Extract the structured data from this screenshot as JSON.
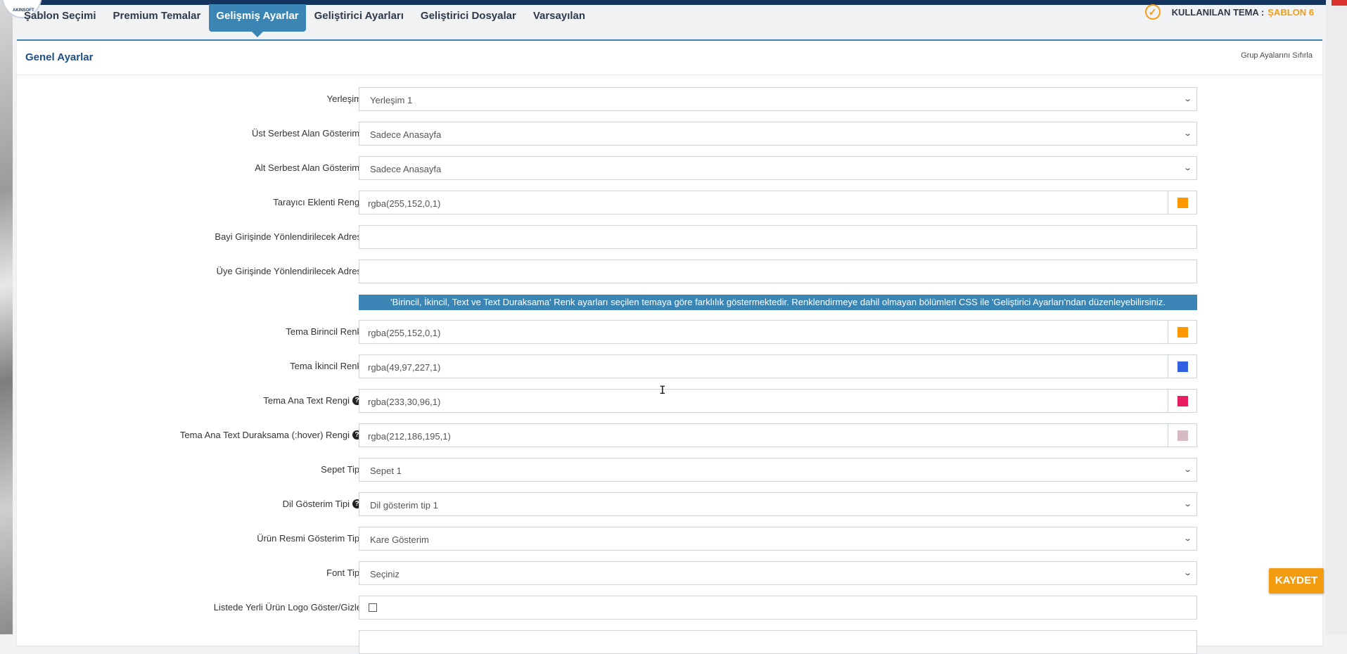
{
  "logo": {
    "text": "AKINSOFT"
  },
  "nav": {
    "tabs": [
      {
        "label": "Şablon Seçimi"
      },
      {
        "label": "Premium Temalar"
      },
      {
        "label": "Gelişmiş Ayarlar"
      },
      {
        "label": "Geliştirici Ayarları"
      },
      {
        "label": "Geliştirici Dosyalar"
      },
      {
        "label": "Varsayılan"
      }
    ],
    "active_index": 2
  },
  "active_theme": {
    "label": "KULLANILAN TEMA :",
    "name": "ŞABLON 6",
    "icon": "check-circle-icon"
  },
  "panel": {
    "title": "Genel Ayarlar",
    "reset_link": "Grup Ayalarını Sıfırla"
  },
  "form": {
    "layout": {
      "label": "Yerleşim",
      "value": "Yerleşim 1"
    },
    "top_free_area": {
      "label": "Üst Serbest Alan Gösterimi",
      "value": "Sadece Anasayfa"
    },
    "bottom_free_area": {
      "label": "Alt Serbest Alan Gösterimi",
      "value": "Sadece Anasayfa"
    },
    "browser_addon_color": {
      "label": "Tarayıcı Eklenti Rengi",
      "value": "rgba(255,152,0,1)",
      "swatch": "#ff9800"
    },
    "dealer_redirect": {
      "label": "Bayi Girişinde Yönlendirilecek Adres",
      "value": ""
    },
    "member_redirect": {
      "label": "Üye Girişinde Yönlendirilecek Adres",
      "value": ""
    },
    "info": "'Birincil, İkincil, Text ve Text Duraksama' Renk ayarları seçilen temaya göre farklılık göstermektedir. Renklendirmeye dahil olmayan bölümleri CSS ile 'Geliştirici Ayarları'ndan düzenleyebilirsiniz.",
    "primary_color": {
      "label": "Tema Birincil Renk",
      "value": "rgba(255,152,0,1)",
      "swatch": "#ff9800"
    },
    "secondary_color": {
      "label": "Tema İkincil Renk",
      "value": "rgba(49,97,227,1)",
      "swatch": "#3161e3"
    },
    "text_color": {
      "label": "Tema Ana Text Rengi",
      "value": "rgba(233,30,96,1)",
      "swatch": "#e91e60"
    },
    "hover_color": {
      "label": "Tema Ana Text Duraksama (:hover) Rengi",
      "value": "rgba(212,186,195,1)",
      "swatch": "#d4bac3"
    },
    "basket_type": {
      "label": "Sepet Tipi",
      "value": "Sepet 1"
    },
    "language_type": {
      "label": "Dil Gösterim Tipi",
      "value": "Dil gösterim tip 1"
    },
    "product_image_type": {
      "label": "Ürün Resmi Gösterim Tipi",
      "value": "Kare Gösterim"
    },
    "font_type": {
      "label": "Font Tipi",
      "value": "Seçiniz"
    },
    "local_logo": {
      "label": "Listede Yerli Ürün Logo Göster/Gizle",
      "checked": false
    }
  },
  "save_button": {
    "label": "KAYDET"
  }
}
